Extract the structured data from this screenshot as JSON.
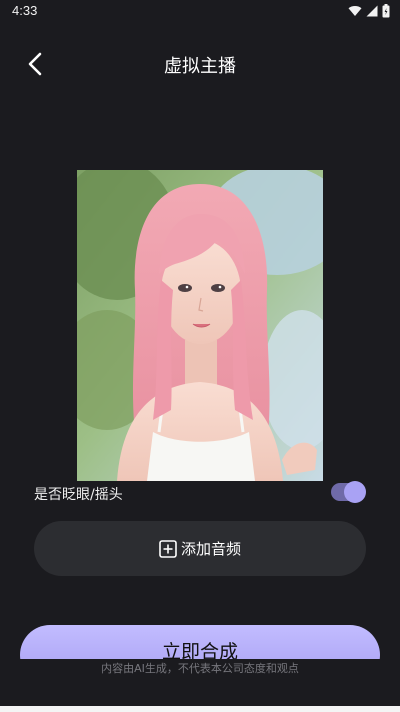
{
  "status_bar": {
    "time": "4:33",
    "icons": [
      "wifi-icon",
      "signal-icon",
      "battery-icon"
    ]
  },
  "header": {
    "title": "虚拟主播",
    "back_icon": "chevron-left-icon"
  },
  "avatar": {
    "image": "pink-haired-girl-portrait"
  },
  "blink_option": {
    "label": "是否眨眼/摇头",
    "enabled": true,
    "accent_color": "#a9a2f4"
  },
  "add_audio": {
    "icon": "plus-square-icon",
    "label": "添加音频"
  },
  "generate": {
    "label": "立即合成",
    "color": "#b8b2fb"
  },
  "disclaimer": "内容由AI生成，不代表本公司态度和观点",
  "theme": {
    "background": "#1b1b1f",
    "button_bg": "#2c2d31"
  }
}
